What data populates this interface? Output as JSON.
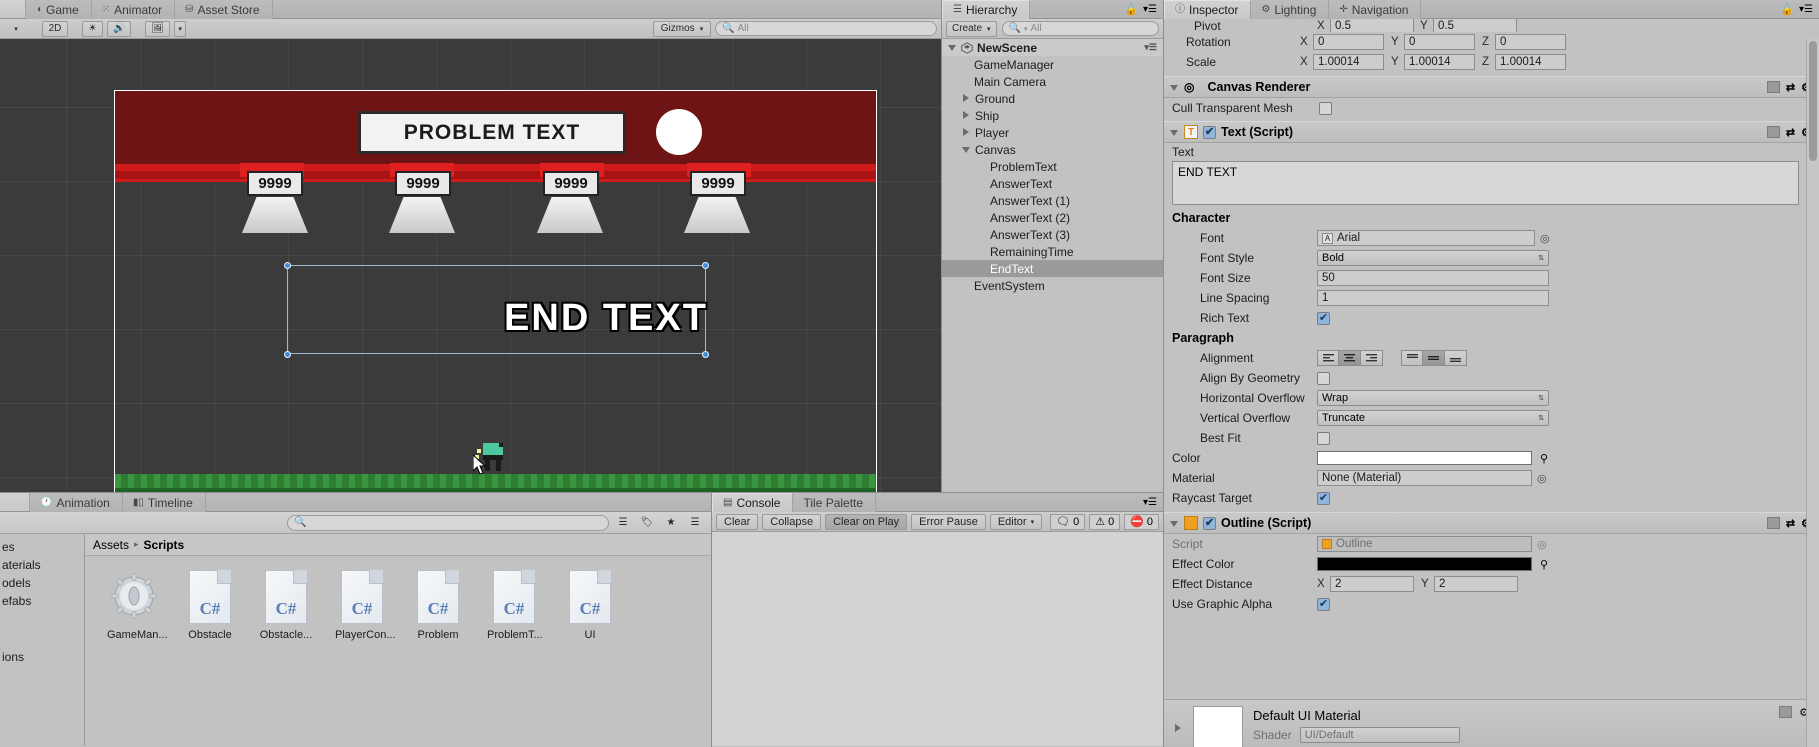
{
  "game_panel": {
    "tabs": [
      {
        "label": "Game",
        "icon": "game-icon",
        "active": false
      },
      {
        "label": "Animator",
        "icon": "animator-icon",
        "active": false
      },
      {
        "label": "Asset Store",
        "icon": "asset-store-icon",
        "active": false
      }
    ],
    "toolbar": {
      "display_dropdown": "",
      "aspect": "2D",
      "lighting_icon": "sun-icon",
      "audio_icon": "speaker-icon",
      "gizmos_label": "Gizmos",
      "search_placeholder": "All"
    },
    "scene": {
      "problem_text": "PROBLEM TEXT",
      "answers": [
        "9999",
        "9999",
        "9999",
        "9999"
      ],
      "end_text": "END TEXT"
    }
  },
  "hierarchy": {
    "tab_label": "Hierarchy",
    "tab_icon": "hierarchy-icon",
    "create_label": "Create",
    "search_placeholder": "All",
    "items": [
      {
        "label": "NewScene",
        "depth": 0,
        "foldout": "open",
        "scene": true
      },
      {
        "label": "GameManager",
        "depth": 1,
        "foldout": "none"
      },
      {
        "label": "Main Camera",
        "depth": 1,
        "foldout": "none"
      },
      {
        "label": "Ground",
        "depth": 1,
        "foldout": "closed"
      },
      {
        "label": "Ship",
        "depth": 1,
        "foldout": "closed"
      },
      {
        "label": "Player",
        "depth": 1,
        "foldout": "closed"
      },
      {
        "label": "Canvas",
        "depth": 1,
        "foldout": "open"
      },
      {
        "label": "ProblemText",
        "depth": 2,
        "foldout": "none"
      },
      {
        "label": "AnswerText",
        "depth": 2,
        "foldout": "none"
      },
      {
        "label": "AnswerText (1)",
        "depth": 2,
        "foldout": "none"
      },
      {
        "label": "AnswerText (2)",
        "depth": 2,
        "foldout": "none"
      },
      {
        "label": "AnswerText (3)",
        "depth": 2,
        "foldout": "none"
      },
      {
        "label": "RemainingTime",
        "depth": 2,
        "foldout": "none"
      },
      {
        "label": "EndText",
        "depth": 2,
        "foldout": "none",
        "selected": true
      },
      {
        "label": "EventSystem",
        "depth": 1,
        "foldout": "none"
      }
    ]
  },
  "inspector": {
    "tabs": [
      {
        "label": "Inspector",
        "icon": "info-icon",
        "active": true
      },
      {
        "label": "Lighting",
        "icon": "lighting-icon",
        "active": false
      },
      {
        "label": "Navigation",
        "icon": "navigation-icon",
        "active": false
      }
    ],
    "transform_partial": {
      "pivot_label": "Pivot",
      "pivot_x_axis": "X",
      "pivot_x": "0.5",
      "pivot_y_axis": "Y",
      "pivot_y": "0.5",
      "rotation_label": "Rotation",
      "rotation_x_axis": "X",
      "rotation_x": "0",
      "rotation_y_axis": "Y",
      "rotation_y": "0",
      "rotation_z_axis": "Z",
      "rotation_z": "0",
      "scale_label": "Scale",
      "scale_x_axis": "X",
      "scale_x": "1.00014",
      "scale_y_axis": "Y",
      "scale_y": "1.00014",
      "scale_z_axis": "Z",
      "scale_z": "1.00014"
    },
    "canvas_renderer": {
      "title": "Canvas Renderer",
      "icon": "canvas-renderer-icon",
      "cull_label": "Cull Transparent Mesh",
      "cull_checked": false
    },
    "text_script": {
      "title": "Text (Script)",
      "icon": "text-component-icon",
      "enabled": true,
      "text_label": "Text",
      "text_value": "END TEXT",
      "character_header": "Character",
      "font_label": "Font",
      "font_value": "Arial",
      "font_style_label": "Font Style",
      "font_style_value": "Bold",
      "font_size_label": "Font Size",
      "font_size_value": "50",
      "line_spacing_label": "Line Spacing",
      "line_spacing_value": "1",
      "rich_text_label": "Rich Text",
      "rich_text_checked": true,
      "paragraph_header": "Paragraph",
      "alignment_label": "Alignment",
      "alignment_h_selected": 1,
      "alignment_v_selected": 1,
      "align_geometry_label": "Align By Geometry",
      "align_geometry_checked": false,
      "h_overflow_label": "Horizontal Overflow",
      "h_overflow_value": "Wrap",
      "v_overflow_label": "Vertical Overflow",
      "v_overflow_value": "Truncate",
      "best_fit_label": "Best Fit",
      "best_fit_checked": false,
      "color_label": "Color",
      "color_value": "#ffffff",
      "material_label": "Material",
      "material_value": "None (Material)",
      "raycast_label": "Raycast Target",
      "raycast_checked": true
    },
    "outline_script": {
      "title": "Outline (Script)",
      "icon": "script-icon",
      "enabled": true,
      "script_label": "Script",
      "script_value": "Outline",
      "effect_color_label": "Effect Color",
      "effect_color_value": "#000000",
      "effect_distance_label": "Effect Distance",
      "effect_distance_x_axis": "X",
      "effect_distance_x": "2",
      "effect_distance_y_axis": "Y",
      "effect_distance_y": "2",
      "use_graphic_alpha_label": "Use Graphic Alpha",
      "use_graphic_alpha_checked": true
    },
    "material_preview": {
      "title": "Default UI Material",
      "shader_label": "Shader",
      "shader_value": "UI/Default"
    }
  },
  "project": {
    "tabs": [
      {
        "label": "Animation",
        "icon": "clock-icon",
        "active": false
      },
      {
        "label": "Timeline",
        "icon": "timeline-icon",
        "active": false
      }
    ],
    "search_placeholder": "",
    "breadcrumb": [
      "Assets",
      "Scripts"
    ],
    "tree_items": [
      "es",
      "aterials",
      "odels",
      "efabs",
      "ions"
    ],
    "assets": [
      {
        "name": "GameMan...",
        "type": "prefab",
        "badge": ""
      },
      {
        "name": "Obstacle",
        "type": "csharp",
        "badge": "C#"
      },
      {
        "name": "Obstacle...",
        "type": "csharp",
        "badge": "C#"
      },
      {
        "name": "PlayerCon...",
        "type": "csharp",
        "badge": "C#"
      },
      {
        "name": "Problem",
        "type": "csharp",
        "badge": "C#"
      },
      {
        "name": "ProblemT...",
        "type": "csharp",
        "badge": "C#"
      },
      {
        "name": "UI",
        "type": "csharp",
        "badge": "C#"
      }
    ]
  },
  "console": {
    "tabs": [
      {
        "label": "Console",
        "icon": "console-icon",
        "active": true
      },
      {
        "label": "Tile Palette",
        "icon": "tile-palette-icon",
        "active": false
      }
    ],
    "buttons": {
      "clear": "Clear",
      "collapse": "Collapse",
      "clear_on_play": "Clear on Play",
      "error_pause": "Error Pause",
      "editor": "Editor"
    },
    "counts": {
      "log": "0",
      "warning": "0",
      "error": "0"
    }
  },
  "colors": {
    "chrome": "#c2c2c2",
    "selection_blue": "#3d8fdd",
    "checkbox_blue": "#8fb5dc",
    "accent_orange": "#f0a020",
    "sky_red": "#6e1414",
    "band_red": "#cf1b1b",
    "ground_green": "#2e7d32"
  }
}
